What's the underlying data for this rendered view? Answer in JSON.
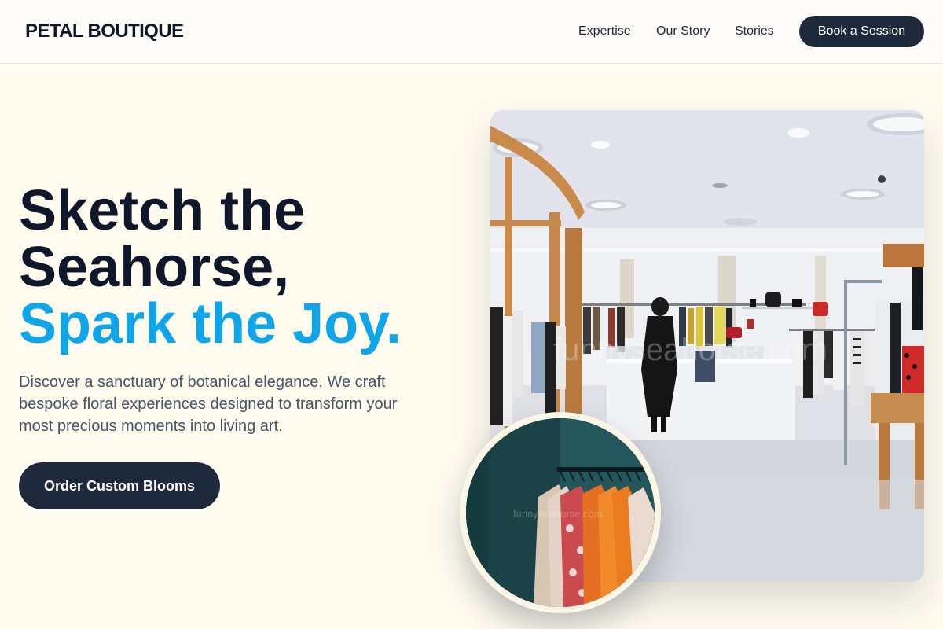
{
  "header": {
    "logo": "PETAL BOUTIQUE",
    "nav": [
      "Expertise",
      "Our Story",
      "Stories"
    ],
    "cta": "Book a Session"
  },
  "hero": {
    "title_line1": "Sketch the",
    "title_line2": "Seahorse,",
    "title_accent": "Spark the Joy.",
    "description": "Discover a sanctuary of botanical elegance. We craft bespoke floral experiences designed to transform your most precious moments into living art.",
    "cta": "Order Custom Blooms"
  },
  "images": {
    "main_watermark": "funnyseahorse.com",
    "circle_watermark": "funnyseahorse.com"
  },
  "colors": {
    "page_bg": "#fffbef",
    "dark": "#1e293b",
    "title": "#0f172a",
    "accent": "#0ea5e9",
    "body_text": "#475569"
  }
}
